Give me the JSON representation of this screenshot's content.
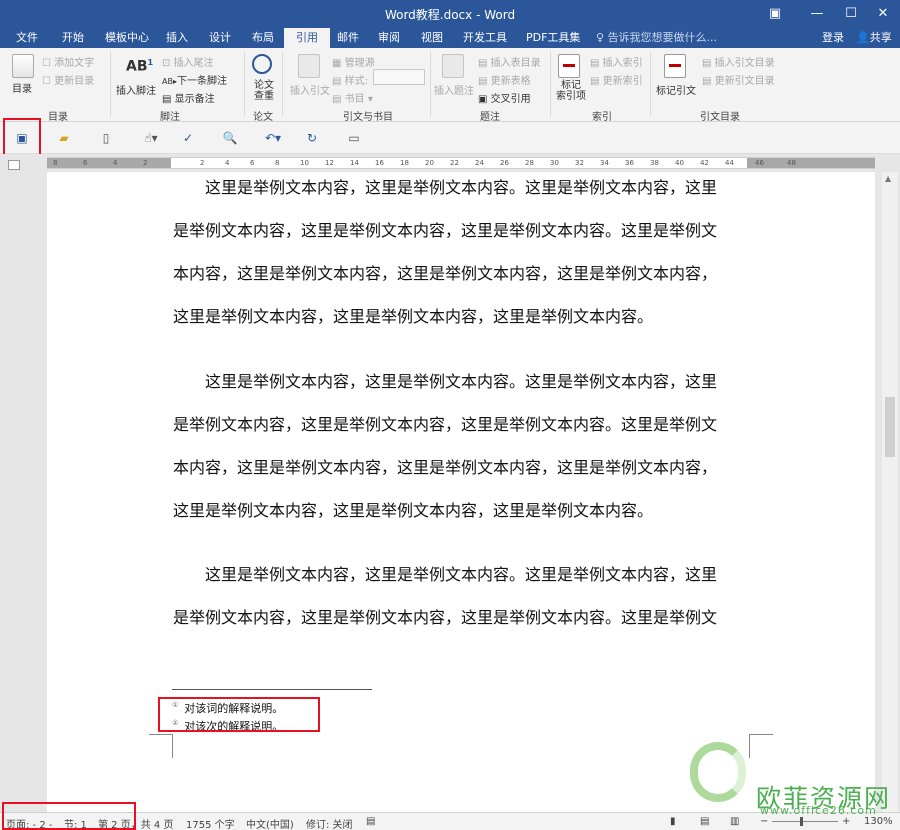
{
  "window": {
    "title": "Word教程.docx - Word",
    "controls": [
      "▣",
      "—",
      "☐",
      "✕"
    ]
  },
  "tabs": [
    "文件",
    "开始",
    "模板中心",
    "插入",
    "设计",
    "布局",
    "引用",
    "邮件",
    "审阅",
    "视图",
    "开发工具",
    "PDF工具集"
  ],
  "active_tab": "引用",
  "tell_me": "告诉我您想要做什么...",
  "login": "登录",
  "share": "共享",
  "ribbon": {
    "toc": {
      "label": "目录",
      "add_text": "添加文字",
      "update": "更新目录",
      "group": "目录"
    },
    "footnotes": {
      "insert": "插入脚注",
      "insert_endnote": "插入尾注",
      "next": "下一条脚注",
      "show": "显示备注",
      "group": "脚注"
    },
    "research": {
      "label": "论文\n查重",
      "group": "论文"
    },
    "citations": {
      "insert": "插入引文",
      "manage": "管理源",
      "style": "样式:",
      "biblio": "书目",
      "group": "引文与书目"
    },
    "captions": {
      "insert": "插入题注",
      "table_of_figures": "插入表目录",
      "update_table": "更新表格",
      "cross_ref": "交叉引用",
      "group": "题注"
    },
    "index": {
      "mark": "标记\n索引项",
      "insert": "插入索引",
      "update": "更新索引",
      "group": "索引"
    },
    "authorities": {
      "mark": "标记引文",
      "insert": "插入引文目录",
      "update": "更新引文目录",
      "group": "引文目录"
    }
  },
  "quick_access": [
    "save-icon",
    "open-folder-icon",
    "new-doc-icon",
    "touch-mode-icon",
    "spelling-icon",
    "print-preview-icon",
    "undo-icon",
    "redo-icon",
    "window-icon"
  ],
  "ruler": {
    "marks": [
      "8",
      "6",
      "4",
      "2",
      "2",
      "4",
      "6",
      "8",
      "10",
      "12",
      "14",
      "16",
      "18",
      "20",
      "22",
      "24",
      "26",
      "28",
      "30",
      "32",
      "34",
      "36",
      "38",
      "40",
      "42",
      "44",
      "46",
      "48"
    ]
  },
  "document": {
    "paragraphs": [
      [
        "　　这里是举例文本内容，这里是举例文本内容。这里是举例文本内容，这里",
        "是举例文本内容，这里是举例文本内容，这里是举例文本内容。这里是举例文",
        "本内容，这里是举例文本内容，这里是举例文本内容，这里是举例文本内容，",
        "这里是举例文本内容，这里是举例文本内容，这里是举例文本内容。"
      ],
      [
        "　　这里是举例文本内容，这里是举例文本内容。这里是举例文本内容，这里",
        "是举例文本内容，这里是举例文本内容，这里是举例文本内容。这里是举例文",
        "本内容，这里是举例文本内容，这里是举例文本内容，这里是举例文本内容，",
        "这里是举例文本内容，这里是举例文本内容，这里是举例文本内容。"
      ],
      [
        "　　这里是举例文本内容，这里是举例文本内容。这里是举例文本内容，这里",
        "是举例文本内容，这里是举例文本内容，这里是举例文本内容。这里是举例文"
      ]
    ],
    "footnotes": [
      {
        "mark": "①",
        "text": "对该词的解释说明。"
      },
      {
        "mark": "②",
        "text": "对该次的解释说明。"
      }
    ]
  },
  "status": {
    "page": "页面: - 2 -",
    "section": "节: 1",
    "page_of": "第 2 页，共 4 页",
    "words": "1755 个字",
    "language": "中文(中国)",
    "track": "修订: 关闭",
    "zoom": "130%"
  },
  "watermark": {
    "cn": "欧菲资源网",
    "url": "www.office26.com"
  },
  "colors": {
    "brand": "#2b579a",
    "highlight": "#e81123",
    "watermark": "#4caf50"
  }
}
